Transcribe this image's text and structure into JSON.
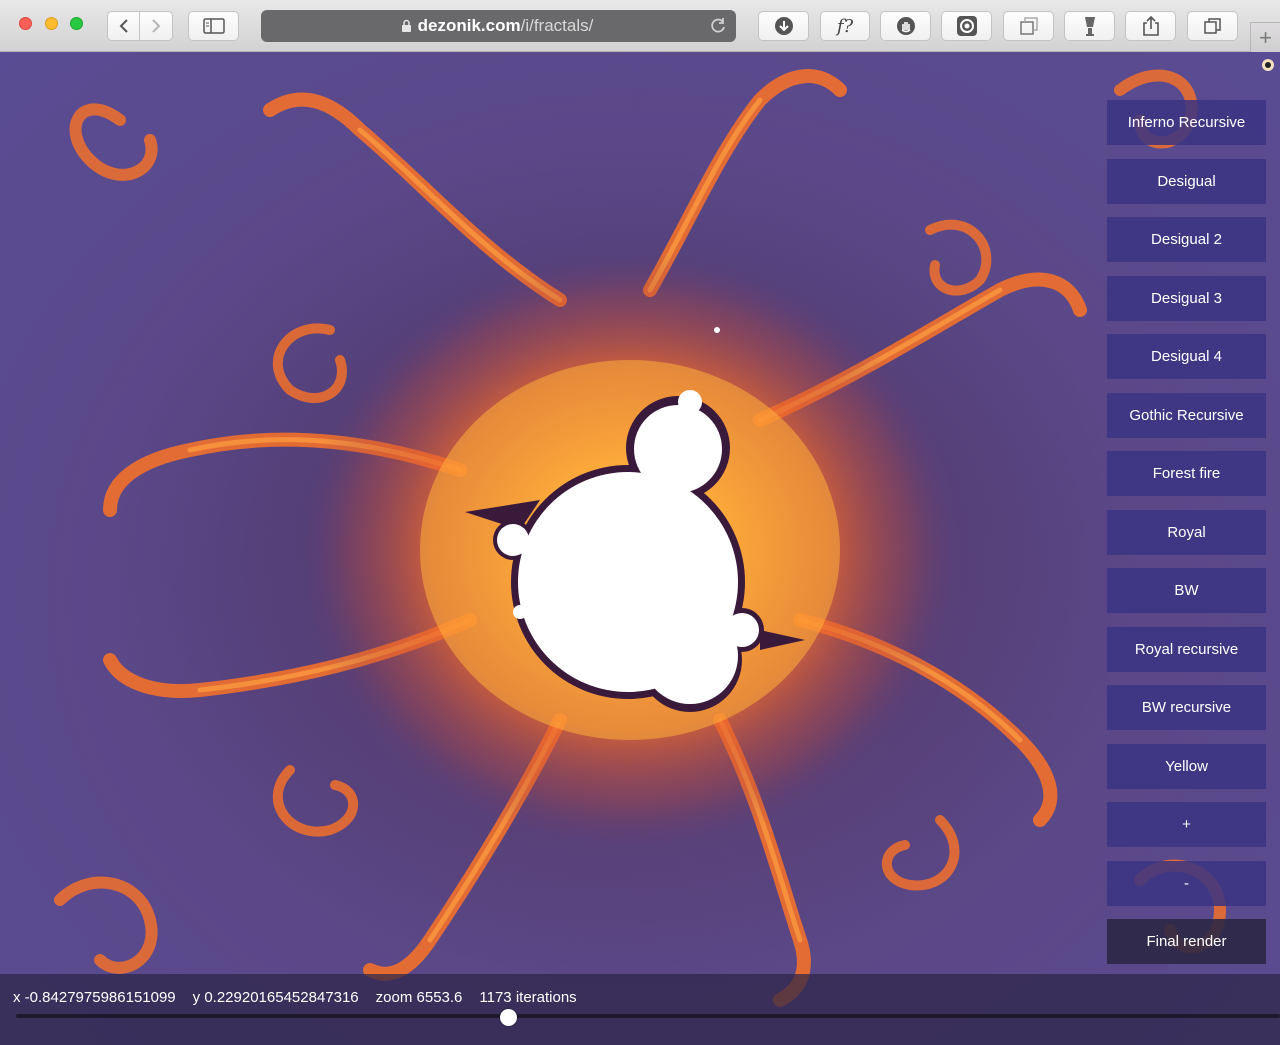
{
  "browser": {
    "url_host": "dezonik.com",
    "url_path": "/i/fractals/"
  },
  "toolbar_icons": [
    "back-icon",
    "forward-icon",
    "sidebar-icon",
    "lock-icon",
    "reload-icon",
    "download-icon",
    "f-question-icon",
    "hand-icon",
    "camera-icon",
    "window-icon",
    "lamp-icon",
    "share-icon",
    "tabs-overview-icon",
    "plus-icon"
  ],
  "extensions": {
    "f_label": "f?"
  },
  "new_tab_label": "+",
  "palettes": [
    {
      "label": "Inferno Recursive"
    },
    {
      "label": "Desigual"
    },
    {
      "label": "Desigual 2"
    },
    {
      "label": "Desigual 3"
    },
    {
      "label": "Desigual 4"
    },
    {
      "label": "Gothic Recursive"
    },
    {
      "label": "Forest fire"
    },
    {
      "label": "Royal"
    },
    {
      "label": "BW"
    },
    {
      "label": "Royal recursive"
    },
    {
      "label": "BW recursive"
    },
    {
      "label": "Yellow"
    },
    {
      "label": "+"
    },
    {
      "label": "-"
    },
    {
      "label": "Final render"
    }
  ],
  "status": {
    "x": "x -0.8427975986151099",
    "y": "y 0.22920165452847316",
    "zoom": "zoom 6553.6",
    "iterations": "1173 iterations"
  },
  "slider": {
    "value_fraction": 0.39
  },
  "colors": {
    "background": "#5a4c94",
    "fractal_orange": "#f4762c",
    "fractal_yellow": "#ffd23a",
    "set_interior": "#ffffff",
    "button_bg": "#3a3482",
    "final_button_bg": "#2b2846"
  }
}
